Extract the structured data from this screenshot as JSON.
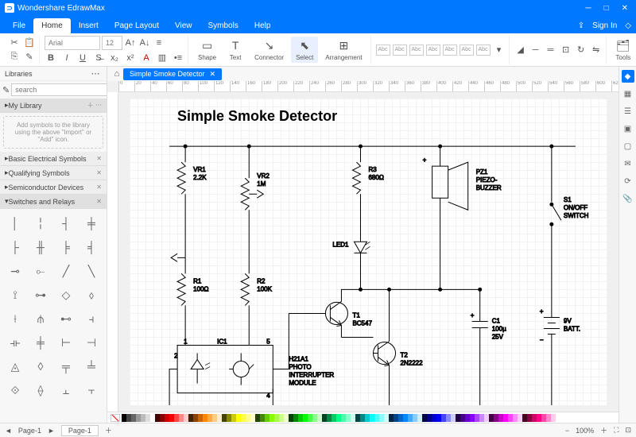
{
  "app": {
    "title": "Wondershare EdrawMax"
  },
  "window": {
    "signin": "Sign In"
  },
  "menu": {
    "file": "File",
    "home": "Home",
    "insert": "Insert",
    "pagelayout": "Page Layout",
    "view": "View",
    "symbols": "Symbols",
    "help": "Help"
  },
  "ribbon": {
    "font": "Arial",
    "size": "12",
    "shape": "Shape",
    "text": "Text",
    "connector": "Connector",
    "select": "Select",
    "arrangement": "Arrangement",
    "abc": "Abc",
    "tools": "Tools"
  },
  "libraries": {
    "title": "Libraries",
    "search": "search",
    "mylib": "My Library",
    "hint": "Add symbols to the library using the above \"Import\" or \"Add\" icon.",
    "cats": [
      "Basic Electrical Symbols",
      "Qualifying Symbols",
      "Semiconductor Devices",
      "Switches and Relays"
    ]
  },
  "doc": {
    "tab": "Simple Smoke Detector"
  },
  "circuit": {
    "title": "Simple Smoke Detector",
    "vr1": "VR1",
    "vr1v": "2.2K",
    "vr2": "VR2",
    "vr2v": "1M",
    "r3": "R3",
    "r3v": "680Ω",
    "r1": "R1",
    "r1v": "100Ω",
    "r2": "R2",
    "r2v": "100K",
    "led1": "LED1",
    "t1": "T1",
    "t1v": "BC547",
    "t2": "T2",
    "t2v": "2N2222",
    "ic1": "IC1",
    "module": "H21A1\nPHOTO\nINTERRUPTER\nMODULE",
    "pz1": "PZ1",
    "pz1v": "PIEZO-\nBUZZER",
    "s1": "S1",
    "s1v": "ON/OFF\nSWITCH",
    "c1": "C1",
    "c1v": "100µ",
    "c1v2": "25V",
    "batt": "9V\nBATT.",
    "pins": {
      "p1": "1",
      "p2": "2",
      "p4": "4",
      "p5": "5"
    }
  },
  "status": {
    "page": "Page-1",
    "zoom": "100%"
  }
}
